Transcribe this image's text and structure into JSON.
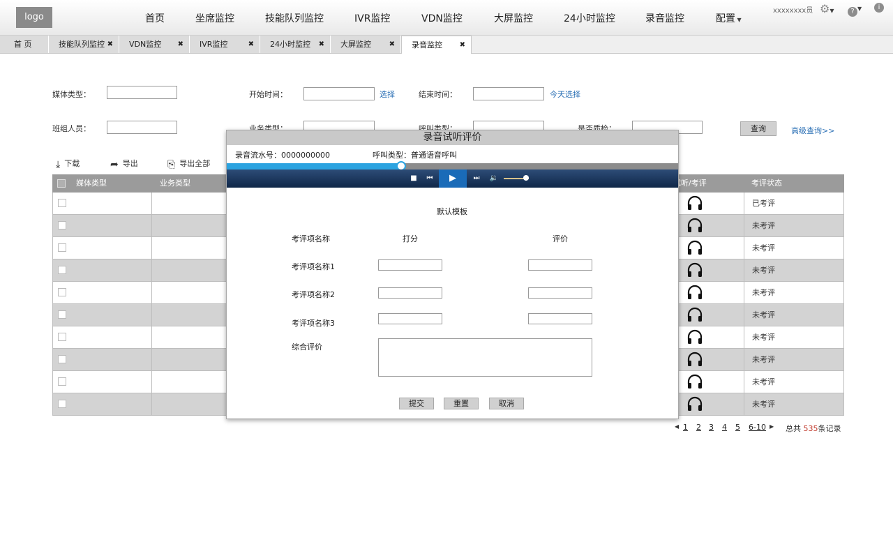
{
  "header": {
    "logo": "logo",
    "nav": [
      "首页",
      "坐席监控",
      "技能队列监控",
      "IVR监控",
      "VDN监控",
      "大屏监控",
      "24小时监控",
      "录音监控",
      "配置"
    ],
    "user": "xxxxxxxx员",
    "help_icon": "?",
    "info_icon": "i"
  },
  "tabs": [
    {
      "label": "首 页",
      "closable": false
    },
    {
      "label": "技能队列监控",
      "closable": true
    },
    {
      "label": "VDN监控",
      "closable": true
    },
    {
      "label": "IVR监控",
      "closable": true
    },
    {
      "label": "24小时监控",
      "closable": true
    },
    {
      "label": "大屏监控",
      "closable": true
    },
    {
      "label": "录音监控",
      "closable": true,
      "active": true
    }
  ],
  "tab_close_glyph": "✖",
  "filters": {
    "media_type": "媒体类型：",
    "start_time": "开始时间：",
    "select_link": "选择",
    "end_time": "结束时间：",
    "today_link": "今天选择",
    "group_member": "班组人员：",
    "business_type": "业务类型：",
    "call_type": "呼叫类型：",
    "qc": "是否质检：",
    "query_button": "查询",
    "advanced_link": "高级查询>>"
  },
  "toolbar": {
    "download": "下载",
    "export": "导出",
    "export_all": "导出全部"
  },
  "table": {
    "headers": {
      "media_type": "媒体类型",
      "business_type": "业务类型",
      "listen": "试听/考评",
      "status": "考评状态"
    },
    "rows": [
      "已考评",
      "未考评",
      "未考评",
      "未考评",
      "未考评",
      "未考评",
      "未考评",
      "未考评",
      "未考评",
      "未考评"
    ]
  },
  "pagination": {
    "pages": [
      "1",
      "2",
      "3",
      "4",
      "5",
      "6-10"
    ],
    "total_prefix": "总共 ",
    "total_count": "535",
    "total_suffix": "条记录"
  },
  "dialog": {
    "title": "录音试听评价",
    "serial": "录音流水号：0000000000",
    "call_type": "呼叫类型：普通语音呼叫",
    "progress": 0.385,
    "volume": 0.9,
    "template": "默认模板",
    "col_item": "考评项名称",
    "col_score": "打分",
    "col_comment": "评价",
    "items": [
      "考评项名称1",
      "考评项名称2",
      "考评项名称3"
    ],
    "overall": "综合评价",
    "submit": "提交",
    "reset": "重置",
    "cancel": "取消"
  },
  "colors": {
    "accent": "#2ba3e0",
    "player_bg": "#173358",
    "count_red": "#c0392b"
  }
}
